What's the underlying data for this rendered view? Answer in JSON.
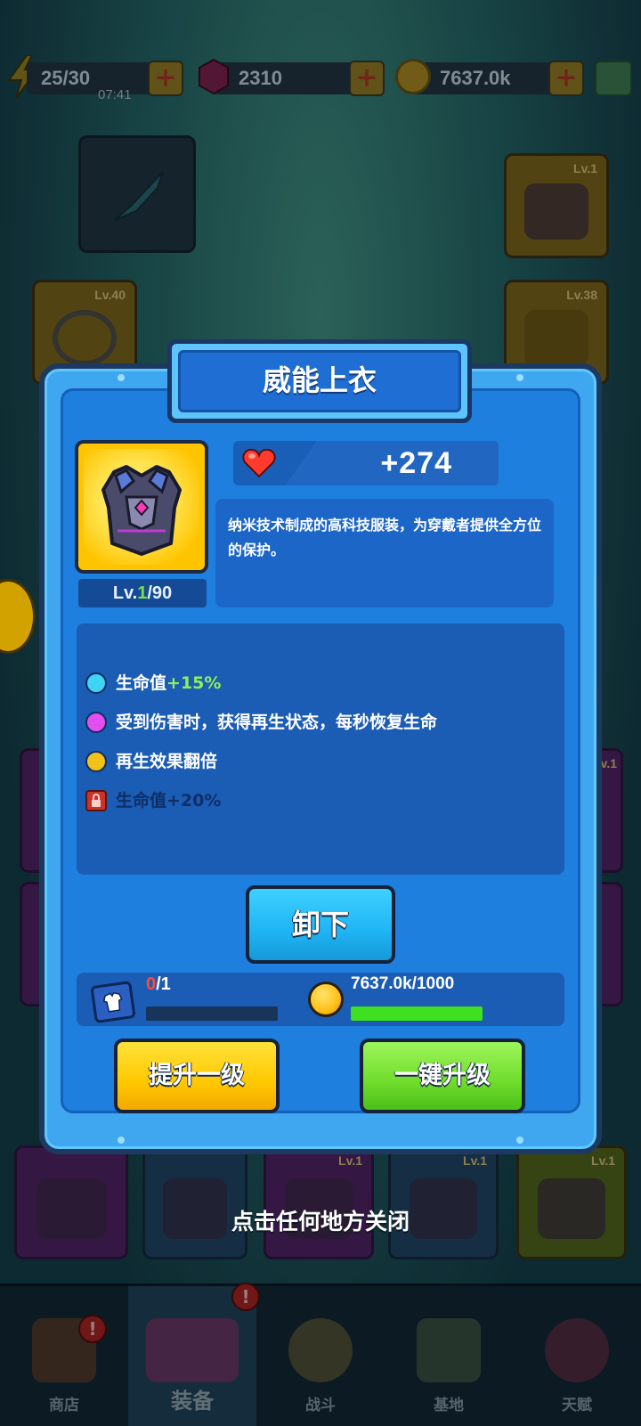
{
  "hud": {
    "energy": "25/30",
    "timer": "07:41",
    "gems": "2310",
    "coins": "7637.0k"
  },
  "slots": {
    "top_right_lv": "Lv.1",
    "left_lv": "Lv.40",
    "right_lv": "Lv.38",
    "right_mid_lv": "Lv.1",
    "row_bottom": [
      "Lv.1",
      "Lv.1",
      "Lv.1"
    ]
  },
  "modal": {
    "title": "威能上衣",
    "level_prefix": "Lv.",
    "level_current": "1",
    "level_max": "/90",
    "stat_value": "+274",
    "description": "纳米技术制成的高科技服装，为穿戴者提供全方位的保护。",
    "effects": [
      {
        "text": "生命值",
        "highlight": "+15%",
        "color": "#3fd3f5",
        "locked": false
      },
      {
        "text": "受到伤害时，获得再生状态，每秒恢复生命",
        "highlight": "",
        "color": "#e14ff0",
        "locked": false
      },
      {
        "text": "再生效果翻倍",
        "highlight": "",
        "color": "#f2c21a",
        "locked": false
      },
      {
        "text": "生命值+20%",
        "highlight": "",
        "color": "#c9332a",
        "locked": true
      }
    ],
    "unequip_button": "卸下",
    "scroll_have": "0",
    "scroll_need": "/1",
    "scroll_progress": 0.0,
    "coin_cost": "7637.0k/1000",
    "coin_progress": 1.0,
    "upgrade_one_button": "提升一级",
    "upgrade_auto_button": "一键升级"
  },
  "close_hint": "点击任何地方关闭",
  "nav": {
    "tabs": [
      {
        "label": "商店",
        "active": false,
        "badge": "!"
      },
      {
        "label": "装备",
        "active": true,
        "badge": "!"
      },
      {
        "label": "战斗",
        "active": false,
        "badge": ""
      },
      {
        "label": "基地",
        "active": false,
        "badge": ""
      },
      {
        "label": "天赋",
        "active": false,
        "badge": ""
      }
    ]
  },
  "colors": {
    "modal_frame": "#3fa7ef",
    "modal_inner": "#1e7fde",
    "item_card": "#ffc400",
    "unequip_btn": "#1fb4f4",
    "upgrade_one_btn": "#ffc800",
    "upgrade_auto_btn": "#6fdc2b",
    "progress_fill": "#3fe01f"
  }
}
